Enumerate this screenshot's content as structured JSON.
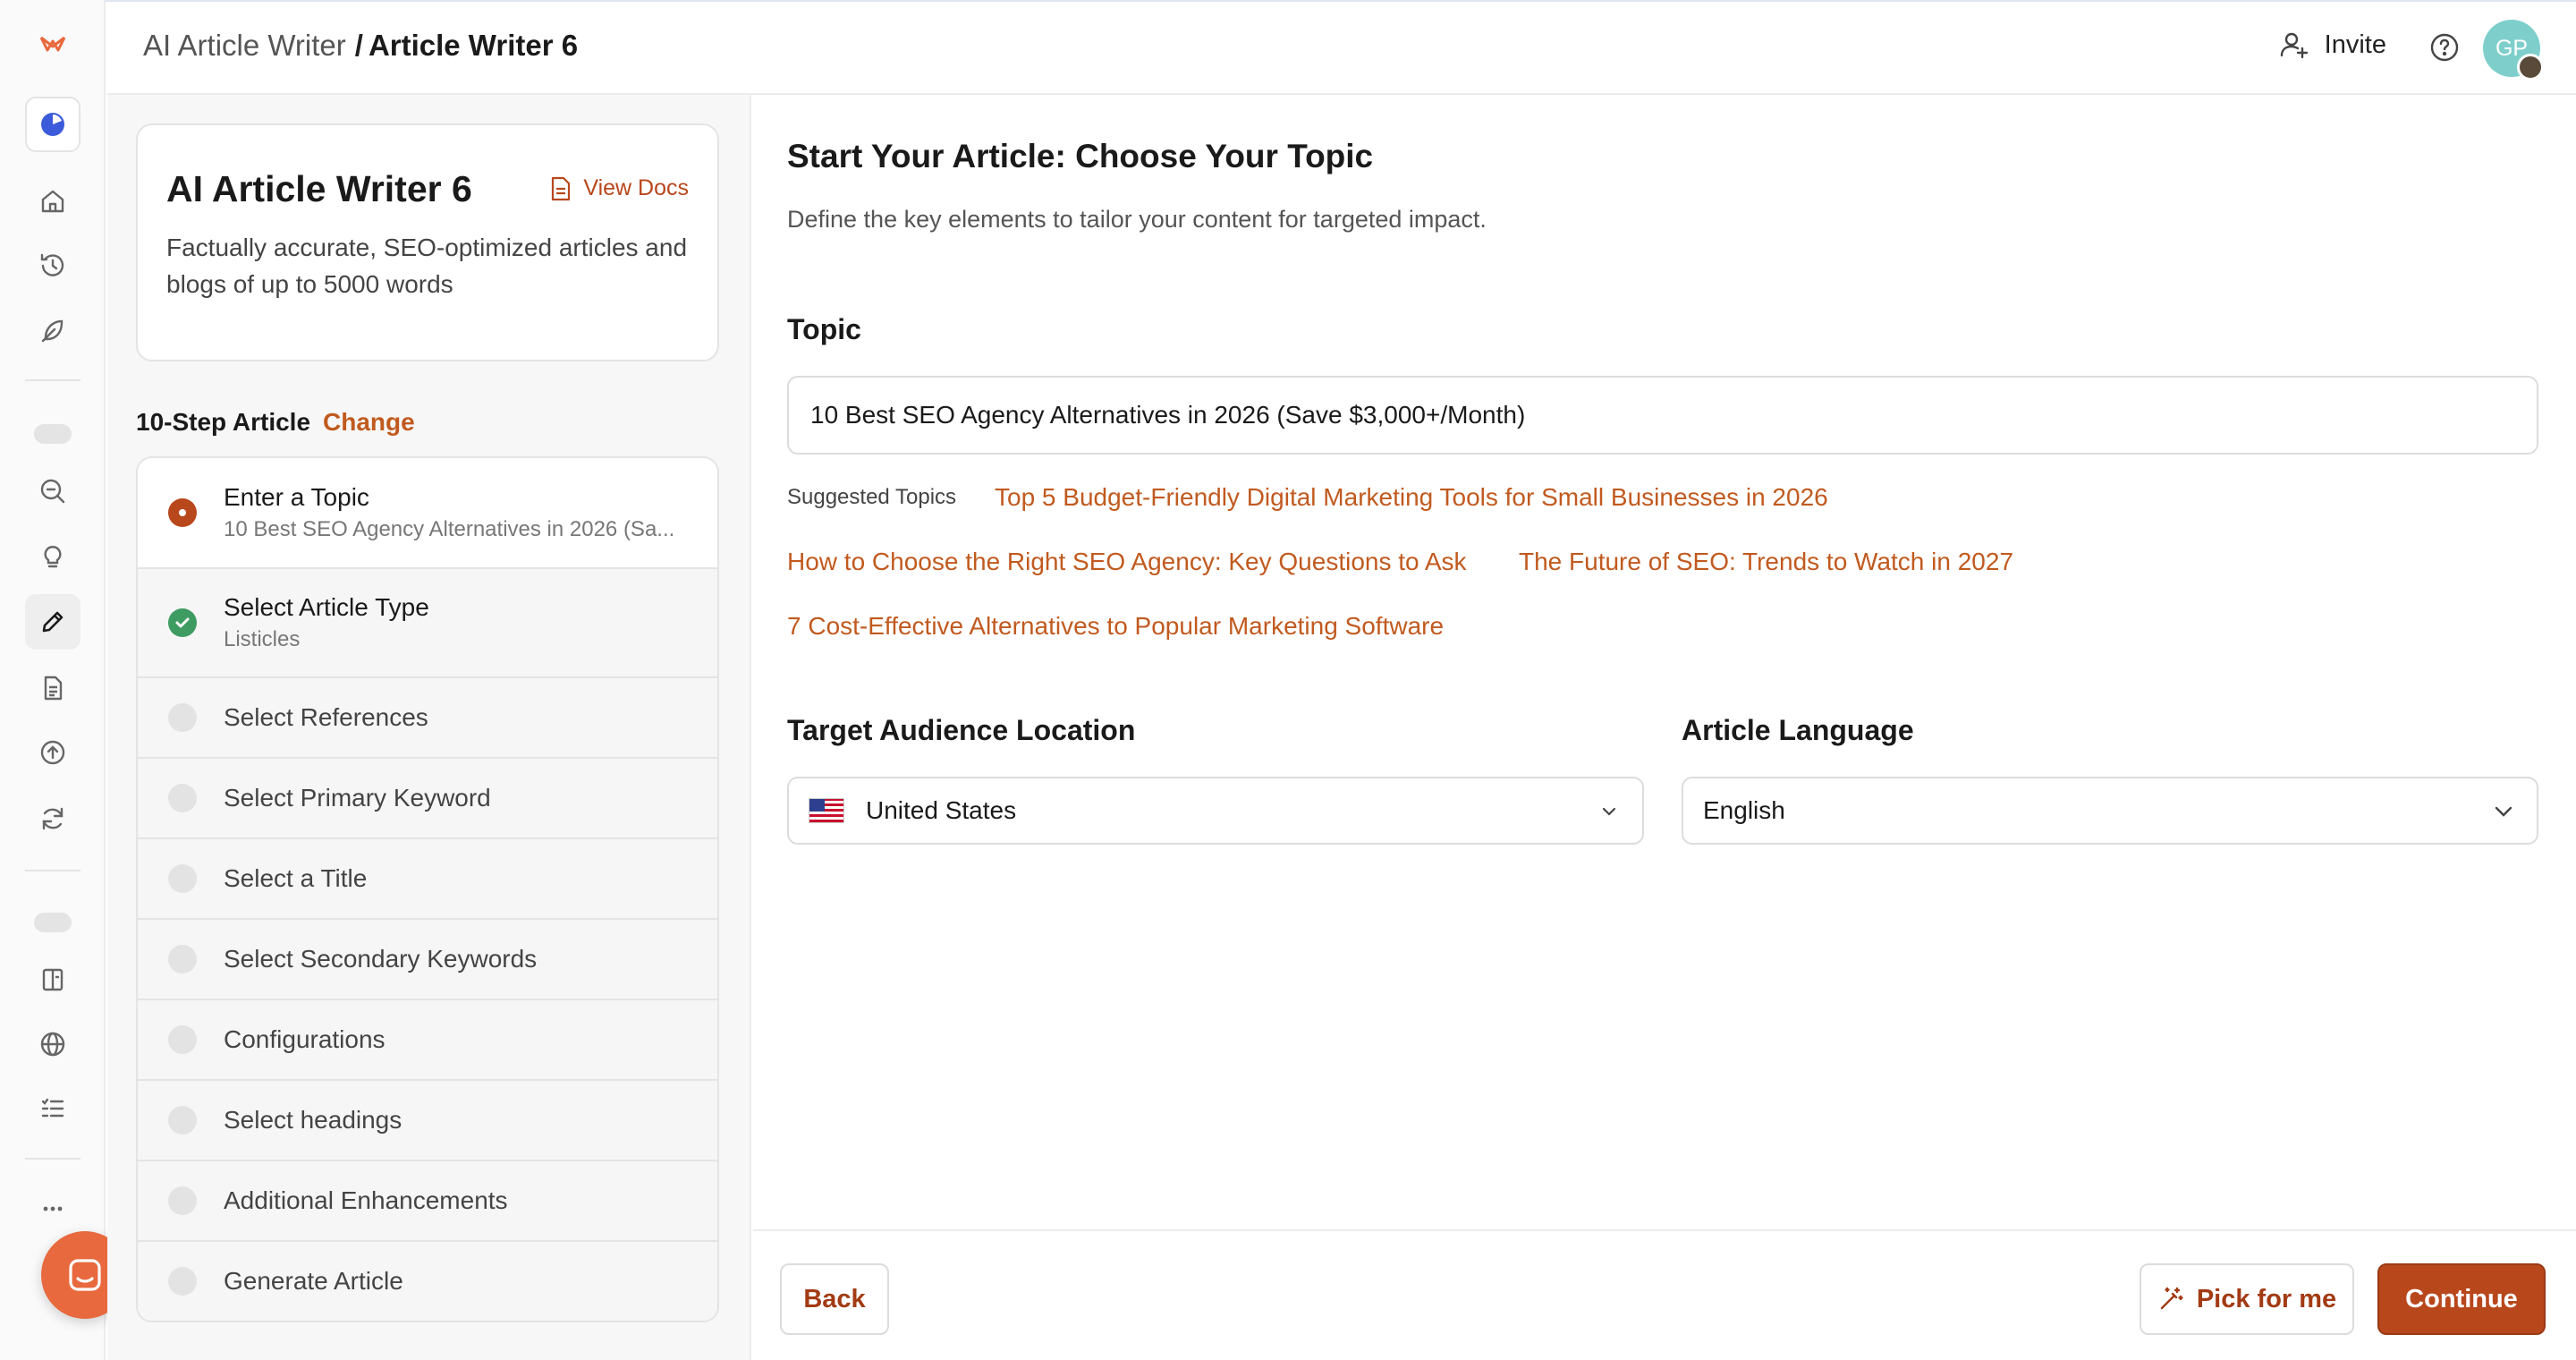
{
  "header": {
    "breadcrumb_parent": "AI Article Writer",
    "breadcrumb_separator": "/",
    "breadcrumb_current": "Article Writer 6",
    "invite_label": "Invite",
    "avatar_initials": "GP"
  },
  "info_card": {
    "title": "AI Article Writer 6",
    "docs_label": "View Docs",
    "description": "Factually accurate, SEO-optimized articles and blogs of up to 5000 words"
  },
  "steps": {
    "heading": "10-Step Article",
    "change_label": "Change",
    "items": [
      {
        "label": "Enter a Topic",
        "sub": "10 Best SEO Agency Alternatives in 2026 (Sa...",
        "status": "current"
      },
      {
        "label": "Select Article Type",
        "sub": "Listicles",
        "status": "done"
      },
      {
        "label": "Select References",
        "sub": "",
        "status": "pending"
      },
      {
        "label": "Select Primary Keyword",
        "sub": "",
        "status": "pending"
      },
      {
        "label": "Select a Title",
        "sub": "",
        "status": "pending"
      },
      {
        "label": "Select Secondary Keywords",
        "sub": "",
        "status": "pending"
      },
      {
        "label": "Configurations",
        "sub": "",
        "status": "pending"
      },
      {
        "label": "Select headings",
        "sub": "",
        "status": "pending"
      },
      {
        "label": "Additional Enhancements",
        "sub": "",
        "status": "pending"
      },
      {
        "label": "Generate Article",
        "sub": "",
        "status": "pending"
      }
    ]
  },
  "main": {
    "title": "Start Your Article: Choose Your Topic",
    "subtitle": "Define the key elements to tailor your content for targeted impact.",
    "topic_label": "Topic",
    "topic_value": "10 Best SEO Agency Alternatives in 2026 (Save $3,000+/Month)",
    "suggested_label": "Suggested Topics",
    "suggested": [
      "Top 5 Budget-Friendly Digital Marketing Tools for Small Businesses in 2026",
      "How to Choose the Right SEO Agency: Key Questions to Ask",
      "The Future of SEO: Trends to Watch in 2027",
      "7 Cost-Effective Alternatives to Popular Marketing Software"
    ],
    "location_label": "Target Audience Location",
    "location_value": "United States",
    "language_label": "Article Language",
    "language_value": "English"
  },
  "footer": {
    "back_label": "Back",
    "pick_label": "Pick for me",
    "continue_label": "Continue"
  },
  "colors": {
    "accent": "#b8471c",
    "link": "#c15a1f",
    "success": "#3e9b62",
    "chat": "#e8693d"
  },
  "rail_icons": [
    "logo-icon",
    "workspace-icon",
    "home-icon",
    "history-icon",
    "feather-icon",
    "search-icon",
    "lightbulb-icon",
    "pencil-icon",
    "document-icon",
    "upload-icon",
    "refresh-icon",
    "book-icon",
    "globe-icon",
    "checklist-icon",
    "more-icon",
    "chat-icon"
  ]
}
